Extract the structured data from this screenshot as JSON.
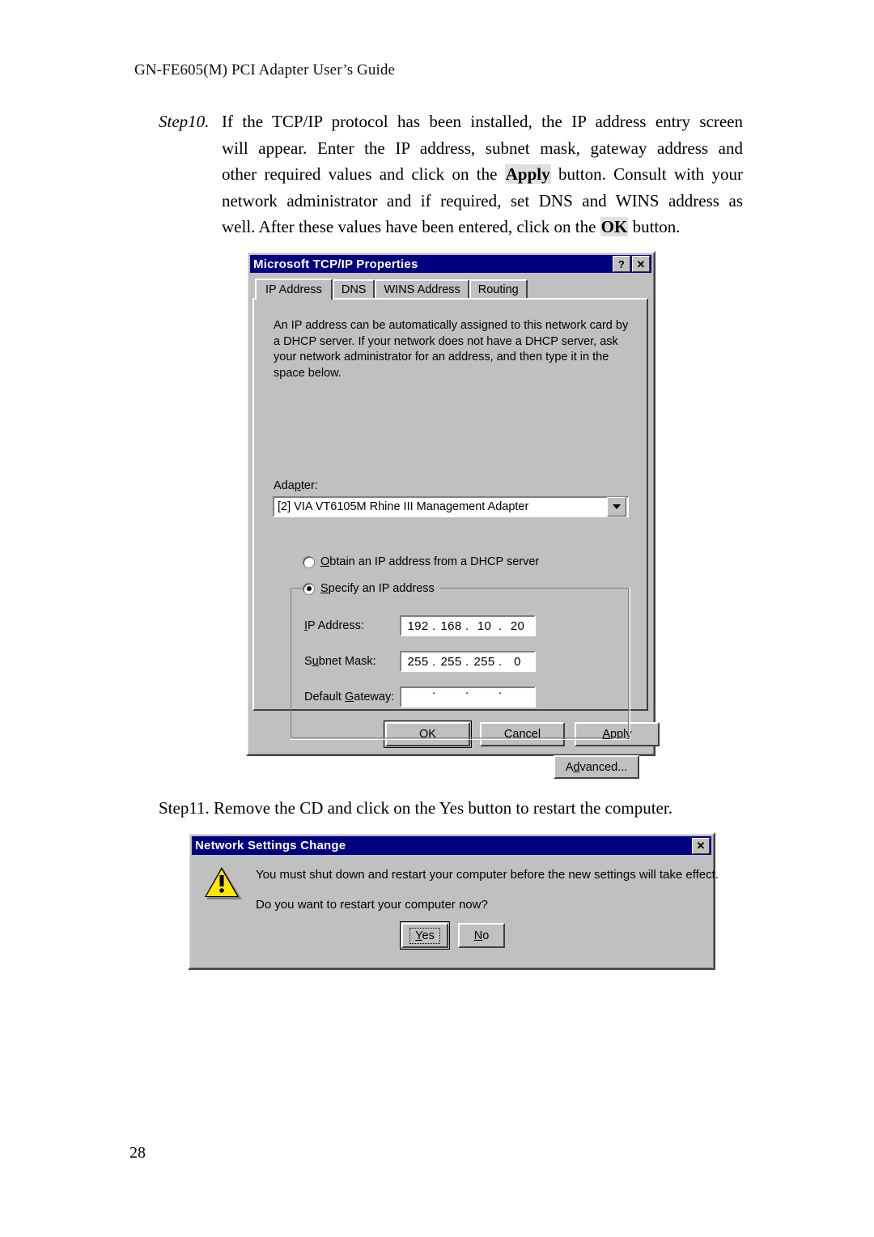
{
  "document": {
    "header": "GN-FE605(M) PCI Adapter User’s Guide",
    "page_number": "28",
    "step10": {
      "label": "Step10.",
      "lines": [
        "If the TCP/IP protocol has been installed, the IP address entry screen",
        "will appear. Enter the IP address, subnet mask, gateway address and"
      ],
      "line3_a": "other required values and click on the ",
      "line3_bold": "Apply",
      "line3_b": " button. Consult with your",
      "line4": "network administrator and if required, set DNS and WINS address as",
      "line5_a": "well. After these values have been entered, click on the ",
      "line5_bold": "OK",
      "line5_b": " button."
    },
    "step11": "Step11. Remove the CD and click on the Yes button to restart the computer."
  },
  "tcpip_dialog": {
    "title": "Microsoft TCP/IP Properties",
    "titlebar_buttons": {
      "help": "?",
      "close": "✕"
    },
    "tabs": [
      {
        "label": "IP Address",
        "active": true
      },
      {
        "label": "DNS",
        "active": false
      },
      {
        "label": "WINS Address",
        "active": false
      },
      {
        "label": "Routing",
        "active": false
      }
    ],
    "description": "An IP address can be automatically assigned to this network card by a DHCP server.  If your network does not have a DHCP server, ask your network administrator for an address, and then type it in the space below.",
    "adapter": {
      "label": "Adapter:",
      "selected": "[2] VIA VT6105M Rhine III Management Adapter"
    },
    "radio_dhcp": {
      "label": "Obtain an IP address from a DHCP server",
      "checked": false
    },
    "radio_static": {
      "label": "Specify an IP address",
      "checked": true
    },
    "fields": {
      "ip_address": {
        "label": "IP Address:",
        "octets": [
          "192",
          "168",
          "10",
          "20"
        ]
      },
      "subnet_mask": {
        "label": "Subnet Mask:",
        "octets": [
          "255",
          "255",
          "255",
          "0"
        ]
      },
      "default_gateway": {
        "label": "Default Gateway:",
        "octets": [
          "",
          "",
          "",
          ""
        ]
      }
    },
    "advanced_button": "Advanced...",
    "buttons": {
      "ok": "OK",
      "cancel": "Cancel",
      "apply": "Apply"
    }
  },
  "netchange_dialog": {
    "title": "Network Settings Change",
    "close_button": "✕",
    "message_line1": "You must shut down and restart your computer before the new settings will take effect.",
    "message_line2": "Do you want to restart your computer now?",
    "buttons": {
      "yes": "Yes",
      "no": "No"
    }
  },
  "colors": {
    "titlebar": "#000080",
    "face": "#c0c0c0",
    "warning": "#ffe800",
    "highlight": "#e0e0e0"
  }
}
